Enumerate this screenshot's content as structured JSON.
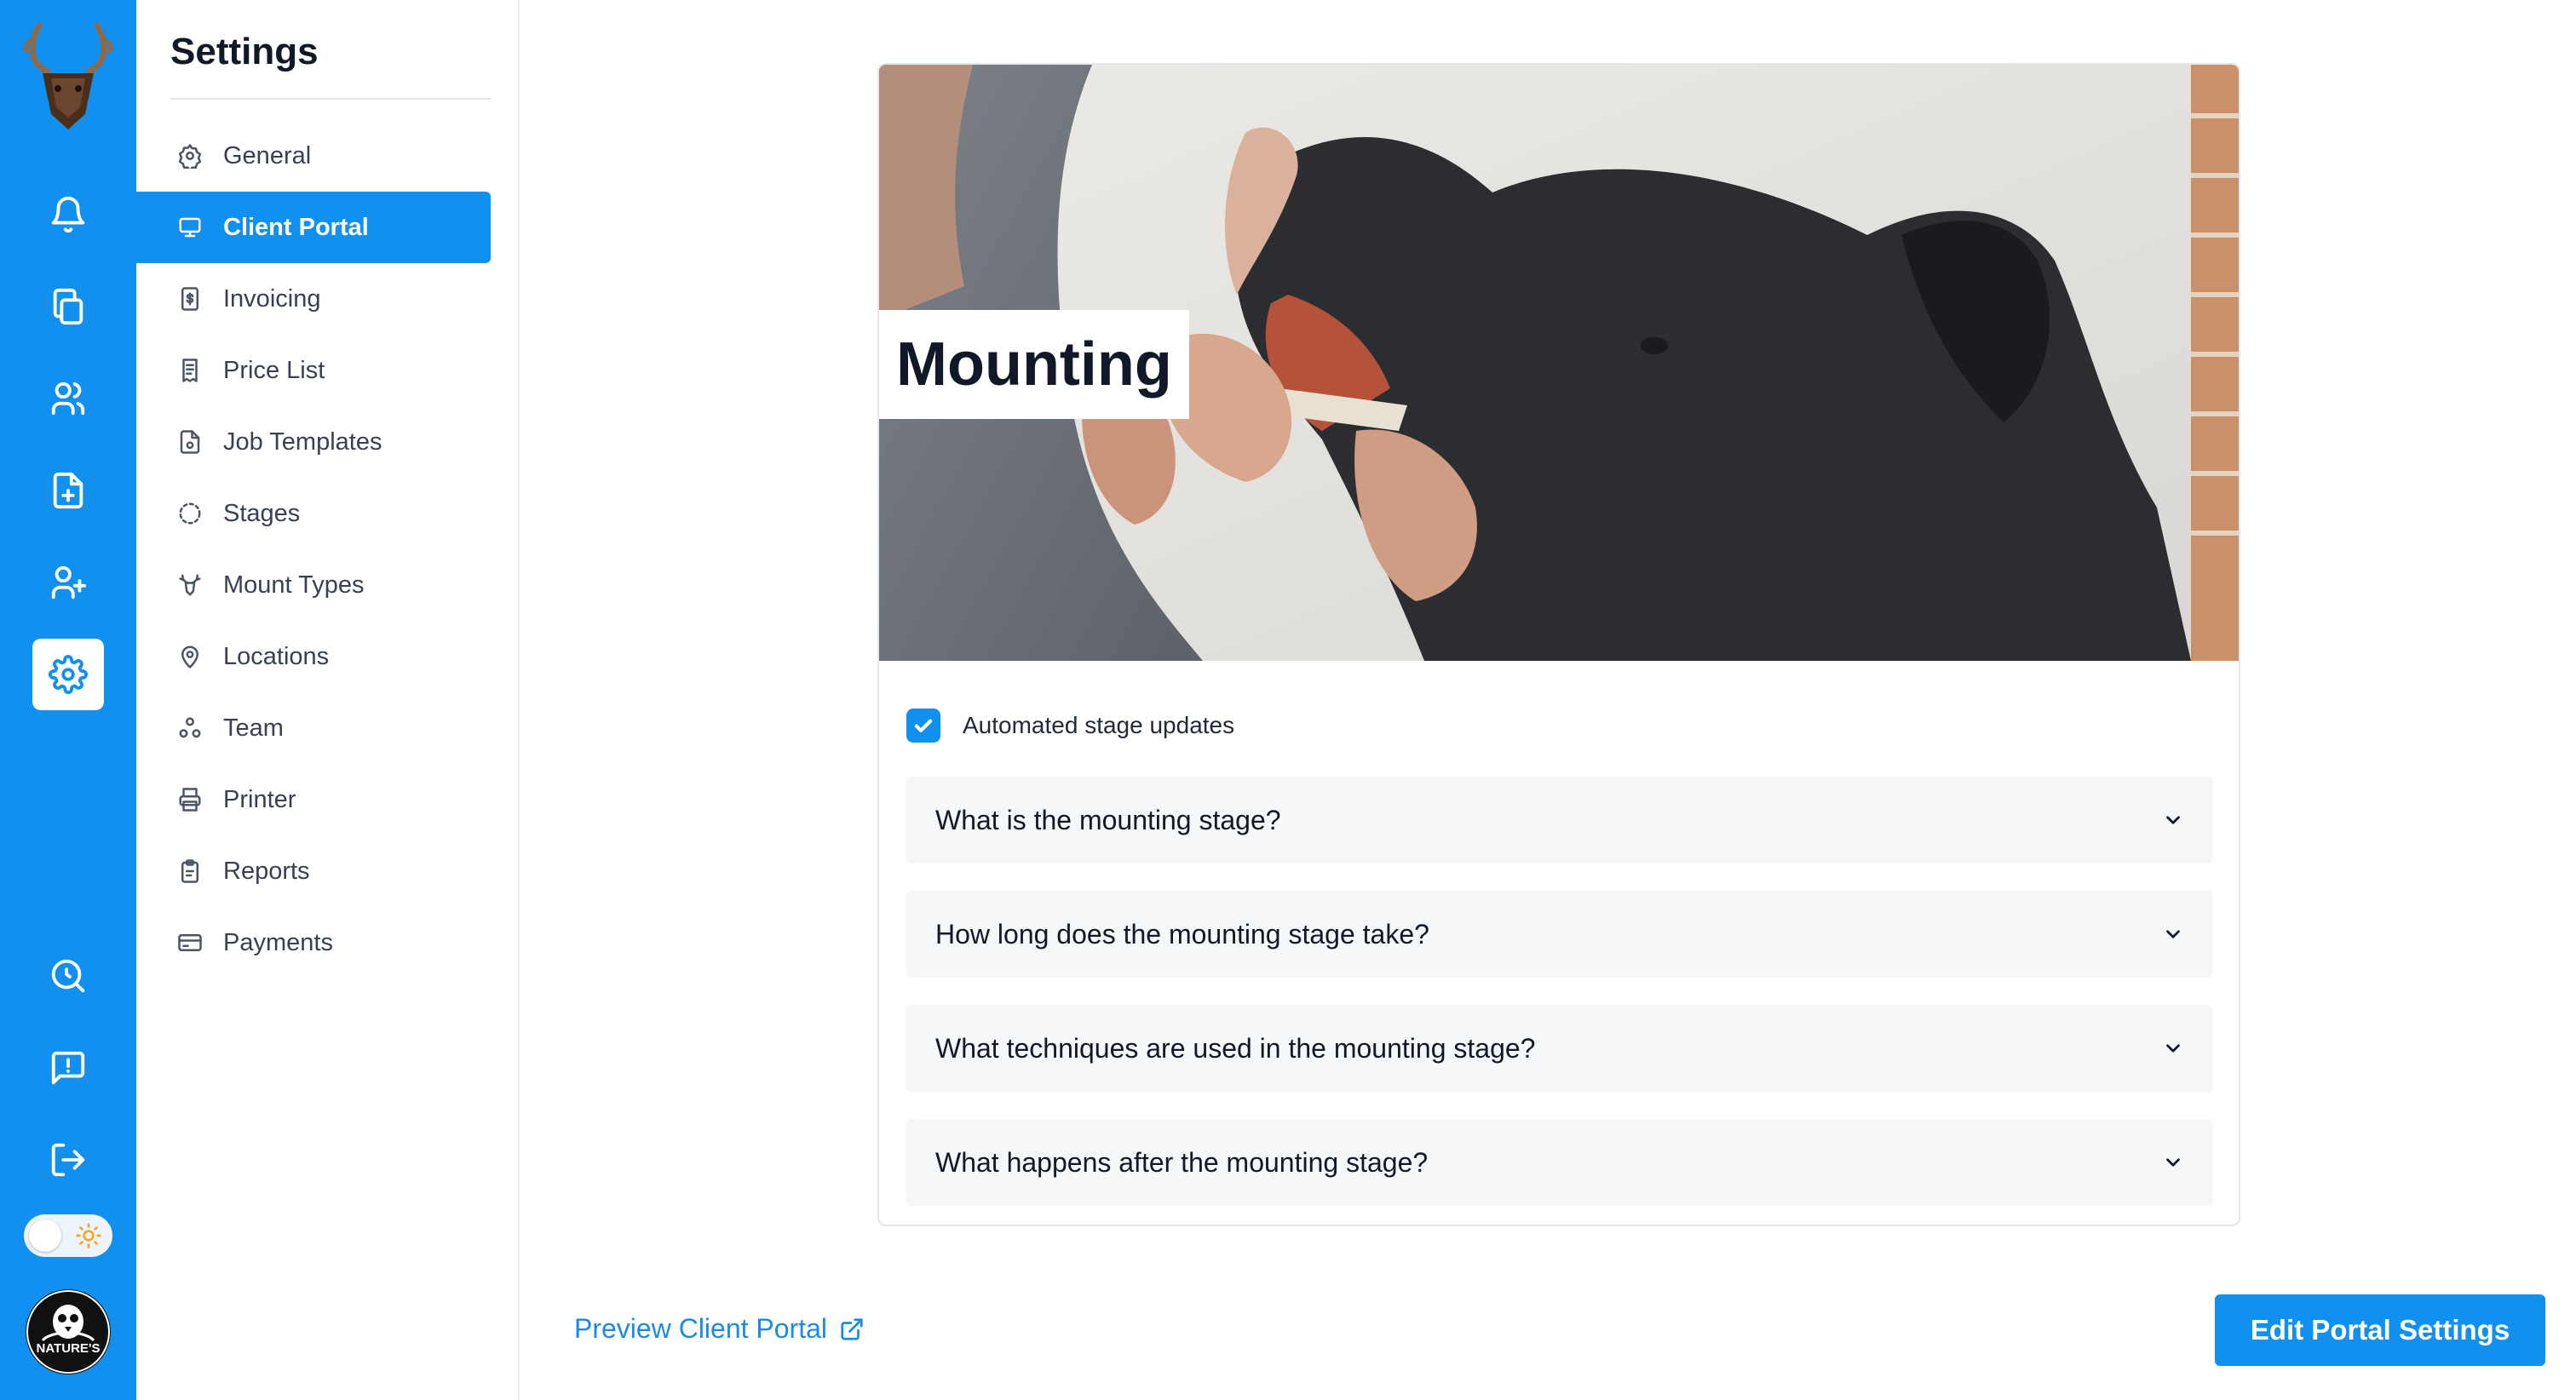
{
  "app": {
    "logo_icon": "deer-skull-logo",
    "accent_color": "#1190f0"
  },
  "rail": {
    "items": [
      {
        "name": "notifications",
        "icon": "bell-icon"
      },
      {
        "name": "documents",
        "icon": "copy-icon"
      },
      {
        "name": "customers",
        "icon": "users-icon"
      },
      {
        "name": "new-job",
        "icon": "file-plus-icon"
      },
      {
        "name": "add-user",
        "icon": "user-plus-icon"
      },
      {
        "name": "settings",
        "icon": "gear-icon",
        "active": true
      },
      {
        "name": "search",
        "icon": "search-icon"
      },
      {
        "name": "feedback",
        "icon": "message-alert-icon"
      },
      {
        "name": "logout",
        "icon": "logout-icon"
      }
    ],
    "theme_toggle": {
      "state": "light",
      "icon": "sun-icon"
    },
    "avatar_text": "NATURE'S"
  },
  "menu": {
    "title": "Settings",
    "items": [
      {
        "label": "General",
        "icon": "gear-icon"
      },
      {
        "label": "Client Portal",
        "icon": "monitor-icon",
        "active": true
      },
      {
        "label": "Invoicing",
        "icon": "invoice-icon"
      },
      {
        "label": "Price List",
        "icon": "receipt-icon"
      },
      {
        "label": "Job Templates",
        "icon": "file-icon"
      },
      {
        "label": "Stages",
        "icon": "loader-icon"
      },
      {
        "label": "Mount Types",
        "icon": "deer-icon"
      },
      {
        "label": "Locations",
        "icon": "map-pin-icon"
      },
      {
        "label": "Team",
        "icon": "team-icon"
      },
      {
        "label": "Printer",
        "icon": "printer-icon"
      },
      {
        "label": "Reports",
        "icon": "clipboard-icon"
      },
      {
        "label": "Payments",
        "icon": "credit-card-icon"
      }
    ]
  },
  "portal": {
    "hero_title": "Mounting",
    "automated_label": "Automated stage updates",
    "automated_checked": true,
    "faqs": [
      "What is the mounting stage?",
      "How long does the mounting stage take?",
      "What techniques are used in the mounting stage?",
      "What happens after the mounting stage?"
    ]
  },
  "footer": {
    "preview_label": "Preview Client Portal",
    "edit_label": "Edit Portal Settings"
  }
}
